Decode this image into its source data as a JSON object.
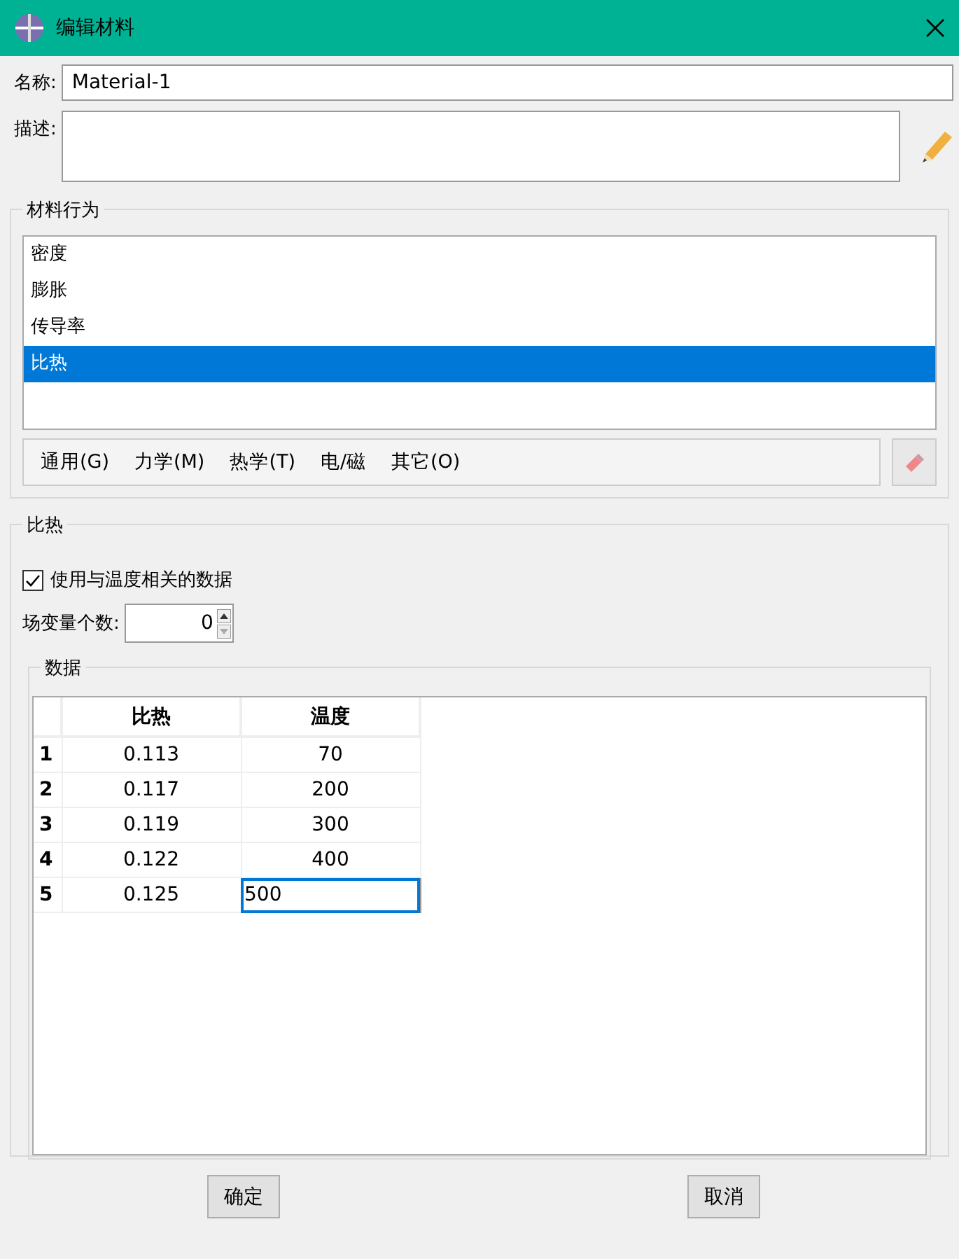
{
  "window": {
    "title": "编辑材料"
  },
  "name_field": {
    "label": "名称:",
    "value": "Material-1"
  },
  "description_field": {
    "label": "描述:"
  },
  "behavior_group": {
    "title": "材料行为",
    "items": [
      {
        "label": "密度",
        "selected": false
      },
      {
        "label": "膨胀",
        "selected": false
      },
      {
        "label": "传导率",
        "selected": false
      },
      {
        "label": "比热",
        "selected": true
      }
    ],
    "menus": [
      "通用(G)",
      "力学(M)",
      "热学(T)",
      "电/磁",
      "其它(O)"
    ]
  },
  "property_group": {
    "title": "比热",
    "temperature_checkbox": {
      "label": "使用与温度相关的数据",
      "checked": true
    },
    "field_variables": {
      "label": "场变量个数:",
      "value": "0"
    },
    "data_group": {
      "title": "数据",
      "columns": [
        "比热",
        "温度"
      ],
      "rows": [
        {
          "index": "1",
          "cells": [
            "0.113",
            "70"
          ],
          "editing": false
        },
        {
          "index": "2",
          "cells": [
            "0.117",
            "200"
          ],
          "editing": false
        },
        {
          "index": "3",
          "cells": [
            "0.119",
            "300"
          ],
          "editing": false
        },
        {
          "index": "4",
          "cells": [
            "0.122",
            "400"
          ],
          "editing": false
        },
        {
          "index": "5",
          "cells": [
            "0.125",
            "500"
          ],
          "editing": true
        }
      ]
    }
  },
  "buttons": [
    "确定",
    "取消"
  ]
}
